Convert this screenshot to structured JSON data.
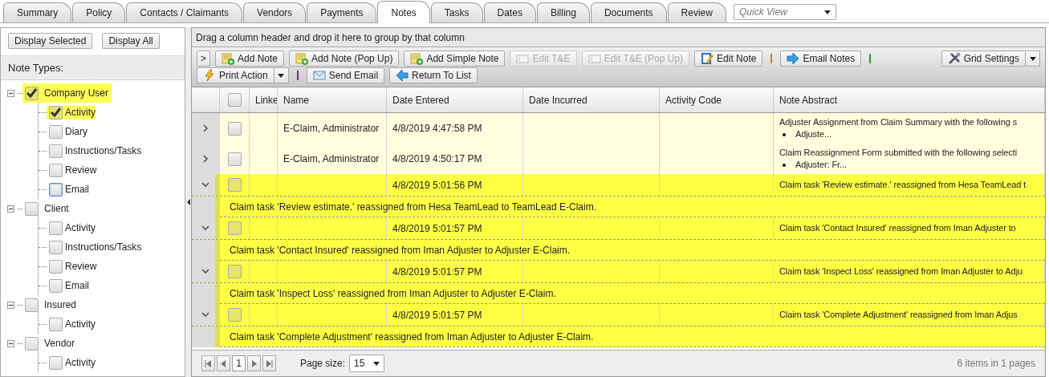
{
  "tabs": [
    {
      "label": "Summary",
      "selected": false
    },
    {
      "label": "Policy",
      "selected": false
    },
    {
      "label": "Contacts / Claimants",
      "selected": false
    },
    {
      "label": "Vendors",
      "selected": false
    },
    {
      "label": "Payments",
      "selected": false
    },
    {
      "label": "Notes",
      "selected": true
    },
    {
      "label": "Tasks",
      "selected": false
    },
    {
      "label": "Dates",
      "selected": false
    },
    {
      "label": "Billing",
      "selected": false
    },
    {
      "label": "Documents",
      "selected": false
    },
    {
      "label": "Review",
      "selected": false
    }
  ],
  "quick_view": {
    "placeholder": "Quick View"
  },
  "sidebar": {
    "buttons": [
      "Display Selected",
      "Display All"
    ],
    "heading": "Note Types:",
    "tree": [
      {
        "label": "Company User",
        "checked": true,
        "highlighted": true,
        "expanded": true,
        "children": [
          {
            "label": "Activity",
            "checked": true,
            "highlighted": true,
            "focused": false
          },
          {
            "label": "Diary",
            "checked": false,
            "highlighted": false,
            "focused": false
          },
          {
            "label": "Instructions/Tasks",
            "checked": false,
            "highlighted": false,
            "focused": false
          },
          {
            "label": "Review",
            "checked": false,
            "highlighted": false,
            "focused": false
          },
          {
            "label": "Email",
            "checked": false,
            "highlighted": false,
            "focused": true
          }
        ]
      },
      {
        "label": "Client",
        "checked": false,
        "highlighted": false,
        "expanded": true,
        "children": [
          {
            "label": "Activity",
            "checked": false,
            "highlighted": false,
            "focused": false
          },
          {
            "label": "Instructions/Tasks",
            "checked": false,
            "highlighted": false,
            "focused": false
          },
          {
            "label": "Review",
            "checked": false,
            "highlighted": false,
            "focused": false
          },
          {
            "label": "Email",
            "checked": false,
            "highlighted": false,
            "focused": false
          }
        ]
      },
      {
        "label": "Insured",
        "checked": false,
        "highlighted": false,
        "expanded": true,
        "children": [
          {
            "label": "Activity",
            "checked": false,
            "highlighted": false,
            "focused": false
          }
        ]
      },
      {
        "label": "Vendor",
        "checked": false,
        "highlighted": false,
        "expanded": true,
        "children": [
          {
            "label": "Activity",
            "checked": false,
            "highlighted": false,
            "focused": false
          }
        ]
      }
    ]
  },
  "group_panel": {
    "hint": "Drag a column header and drop it here to group by that column"
  },
  "toolbar": {
    "expander": ">",
    "lines": [
      [
        {
          "kind": "button",
          "label": "Add Note",
          "disabled": false
        },
        {
          "kind": "button",
          "label": "Add Note (Pop Up)",
          "disabled": false
        },
        {
          "kind": "button",
          "label": "Add Simple Note",
          "disabled": false
        },
        {
          "kind": "button",
          "label": "Edit T&E",
          "disabled": true
        },
        {
          "kind": "button",
          "label": "Edit T&E (Pop Up)",
          "disabled": true
        },
        {
          "kind": "button",
          "label": "Edit Note",
          "disabled": false
        },
        {
          "kind": "separator",
          "color": "#c88a00"
        },
        {
          "kind": "button",
          "label": "Email Notes",
          "disabled": false
        },
        {
          "kind": "separator",
          "color": "#2e9a2e"
        }
      ],
      [
        {
          "kind": "split",
          "label": "Print Action",
          "disabled": false
        },
        {
          "kind": "separator",
          "color": "#7a2a8a"
        },
        {
          "kind": "button",
          "label": "Send Email",
          "disabled": false
        },
        {
          "kind": "button",
          "label": "Return To List",
          "disabled": false
        }
      ]
    ],
    "grid_settings": {
      "label": "Grid Settings"
    }
  },
  "table": {
    "header_checked": false,
    "columns": [
      "Linke",
      "Name",
      "Date Entered",
      "Date Incurred",
      "Activity Code",
      "Note Abstract"
    ],
    "rows": [
      {
        "expanded": false,
        "selected": false,
        "checked": false,
        "name": "E-Claim, Administrator",
        "date_entered": "4/8/2019 4:47:58 PM",
        "note_abstract": "Adjuster Assignment from Claim Summary with the following s",
        "abstract_bullet": "Adjuste..."
      },
      {
        "expanded": false,
        "selected": false,
        "checked": false,
        "name": "E-Claim, Administrator",
        "date_entered": "4/8/2019 4:50:17 PM",
        "note_abstract": "Claim Reassignment Form submitted with the following selecti",
        "abstract_bullet": "Adjuster: Fr..."
      },
      {
        "expanded": true,
        "selected": true,
        "checked": false,
        "date_entered": "4/8/2019 5:01:56 PM",
        "note_abstract": "Claim task 'Review estimate.' reassigned from Hesa TeamLead t",
        "detail": "Claim task 'Review estimate.' reassigned from Hesa TeamLead to TeamLead E-Claim."
      },
      {
        "expanded": true,
        "selected": true,
        "checked": false,
        "date_entered": "4/8/2019 5:01:57 PM",
        "note_abstract": "Claim task 'Contact Insured' reassigned from Iman Adjuster to",
        "detail": "Claim task 'Contact Insured' reassigned from Iman Adjuster to Adjuster E-Claim."
      },
      {
        "expanded": true,
        "selected": true,
        "checked": false,
        "date_entered": "4/8/2019 5:01:57 PM",
        "note_abstract": "Claim task 'Inspect Loss' reassigned from Iman Adjuster to Adju",
        "detail": "Claim task 'Inspect Loss' reassigned from Iman Adjuster to Adjuster E-Claim."
      },
      {
        "expanded": true,
        "selected": true,
        "checked": false,
        "date_entered": "4/8/2019 5:01:57 PM",
        "note_abstract": "Claim task 'Complete Adjustment' reassigned from Iman Adjus",
        "detail": "Claim task 'Complete Adjustment' reassigned from Iman Adjuster to Adjuster E-Claim."
      }
    ]
  },
  "pager": {
    "page": "1",
    "page_size_label": "Page size:",
    "page_size": "15",
    "summary": "6 items in 1 pages"
  }
}
